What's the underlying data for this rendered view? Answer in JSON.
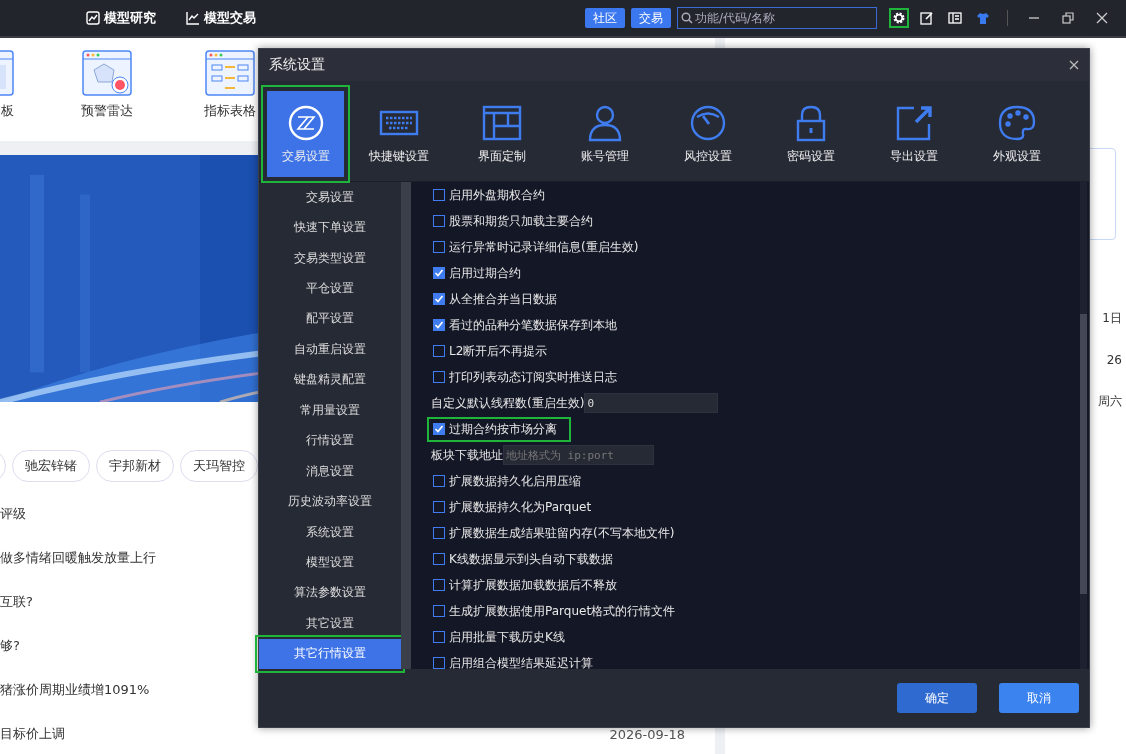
{
  "topbar": {
    "nav": [
      {
        "label": "模型研究"
      },
      {
        "label": "模型交易"
      }
    ],
    "buttons": [
      {
        "label": "社区"
      },
      {
        "label": "交易"
      }
    ],
    "search": {
      "placeholder": "功能/代码/名称"
    },
    "tools": [
      {
        "highlighted": true
      },
      {
        "highlighted": false
      },
      {
        "highlighted": false
      },
      {
        "highlighted": false
      }
    ]
  },
  "background": {
    "apps": [
      {
        "label": "板"
      },
      {
        "label": "预警雷达"
      },
      {
        "label": "指标表格"
      }
    ],
    "tags": [
      "驰宏锌锗",
      "宇邦新材",
      "天玛智控"
    ],
    "news": [
      {
        "title": "评级"
      },
      {
        "title": "做多情绪回暖触发放量上行"
      },
      {
        "title": "互联?"
      },
      {
        "title": "够?"
      },
      {
        "title": "猪涨价周期业绩增1091%"
      },
      {
        "title": "目标价上调",
        "date": "2026-09-18"
      }
    ],
    "side": [
      "1日",
      "26",
      "周六"
    ]
  },
  "dialog": {
    "title": "系统设置",
    "tabs": [
      {
        "label": "交易设置",
        "selected": true,
        "highlighted": true
      },
      {
        "label": "快捷键设置",
        "selected": false,
        "highlighted": false
      },
      {
        "label": "界面定制",
        "selected": false,
        "highlighted": false
      },
      {
        "label": "账号管理",
        "selected": false,
        "highlighted": false
      },
      {
        "label": "风控设置",
        "selected": false,
        "highlighted": false
      },
      {
        "label": "密码设置",
        "selected": false,
        "highlighted": false
      },
      {
        "label": "导出设置",
        "selected": false,
        "highlighted": false
      },
      {
        "label": "外观设置",
        "selected": false,
        "highlighted": false
      }
    ],
    "nav": [
      {
        "label": "交易设置",
        "selected": false,
        "highlighted": false
      },
      {
        "label": "快速下单设置",
        "selected": false,
        "highlighted": false
      },
      {
        "label": "交易类型设置",
        "selected": false,
        "highlighted": false
      },
      {
        "label": "平仓设置",
        "selected": false,
        "highlighted": false
      },
      {
        "label": "配平设置",
        "selected": false,
        "highlighted": false
      },
      {
        "label": "自动重启设置",
        "selected": false,
        "highlighted": false
      },
      {
        "label": "键盘精灵配置",
        "selected": false,
        "highlighted": false
      },
      {
        "label": "常用量设置",
        "selected": false,
        "highlighted": false
      },
      {
        "label": "行情设置",
        "selected": false,
        "highlighted": false
      },
      {
        "label": "消息设置",
        "selected": false,
        "highlighted": false
      },
      {
        "label": "历史波动率设置",
        "selected": false,
        "highlighted": false
      },
      {
        "label": "系统设置",
        "selected": false,
        "highlighted": false
      },
      {
        "label": "模型设置",
        "selected": false,
        "highlighted": false
      },
      {
        "label": "算法参数设置",
        "selected": false,
        "highlighted": false
      },
      {
        "label": "其它设置",
        "selected": false,
        "highlighted": false
      },
      {
        "label": "其它行情设置",
        "selected": true,
        "highlighted": true
      }
    ],
    "settings": [
      {
        "kind": "checkbox",
        "label": "启用外盘期权合约",
        "checked": false,
        "highlighted": false
      },
      {
        "kind": "checkbox",
        "label": "股票和期货只加载主要合约",
        "checked": false,
        "highlighted": false
      },
      {
        "kind": "checkbox",
        "label": "运行异常时记录详细信息(重启生效)",
        "checked": false,
        "highlighted": false
      },
      {
        "kind": "checkbox",
        "label": "启用过期合约",
        "checked": true,
        "highlighted": false
      },
      {
        "kind": "checkbox",
        "label": "从全推合并当日数据",
        "checked": true,
        "highlighted": false
      },
      {
        "kind": "checkbox",
        "label": "看过的品种分笔数据保存到本地",
        "checked": true,
        "highlighted": false
      },
      {
        "kind": "checkbox",
        "label": "L2断开后不再提示",
        "checked": false,
        "highlighted": false
      },
      {
        "kind": "checkbox",
        "label": "打印列表动态订阅实时推送日志",
        "checked": false,
        "highlighted": false
      },
      {
        "kind": "input",
        "label": "自定义默认线程数(重启生效)",
        "value": "0"
      },
      {
        "kind": "checkbox",
        "label": "过期合约按市场分离",
        "checked": true,
        "highlighted": true
      },
      {
        "kind": "input",
        "label": "板块下载地址",
        "placeholder": "地址格式为 ip:port"
      },
      {
        "kind": "checkbox",
        "label": "扩展数据持久化启用压缩",
        "checked": false,
        "highlighted": false
      },
      {
        "kind": "checkbox",
        "label": "扩展数据持久化为Parquet",
        "checked": false,
        "highlighted": false
      },
      {
        "kind": "checkbox",
        "label": "扩展数据生成结果驻留内存(不写本地文件)",
        "checked": false,
        "highlighted": false
      },
      {
        "kind": "checkbox",
        "label": "K线数据显示到头自动下载数据",
        "checked": false,
        "highlighted": false
      },
      {
        "kind": "checkbox",
        "label": "计算扩展数据加载数据后不释放",
        "checked": false,
        "highlighted": false
      },
      {
        "kind": "checkbox",
        "label": "生成扩展数据使用Parquet格式的行情文件",
        "checked": false,
        "highlighted": false
      },
      {
        "kind": "checkbox",
        "label": "启用批量下载历史K线",
        "checked": false,
        "highlighted": false
      },
      {
        "kind": "checkbox",
        "label": "启用组合模型结果延迟计算",
        "checked": false,
        "highlighted": false
      }
    ],
    "buttons": [
      {
        "label": "确定"
      },
      {
        "label": "取消"
      }
    ]
  }
}
